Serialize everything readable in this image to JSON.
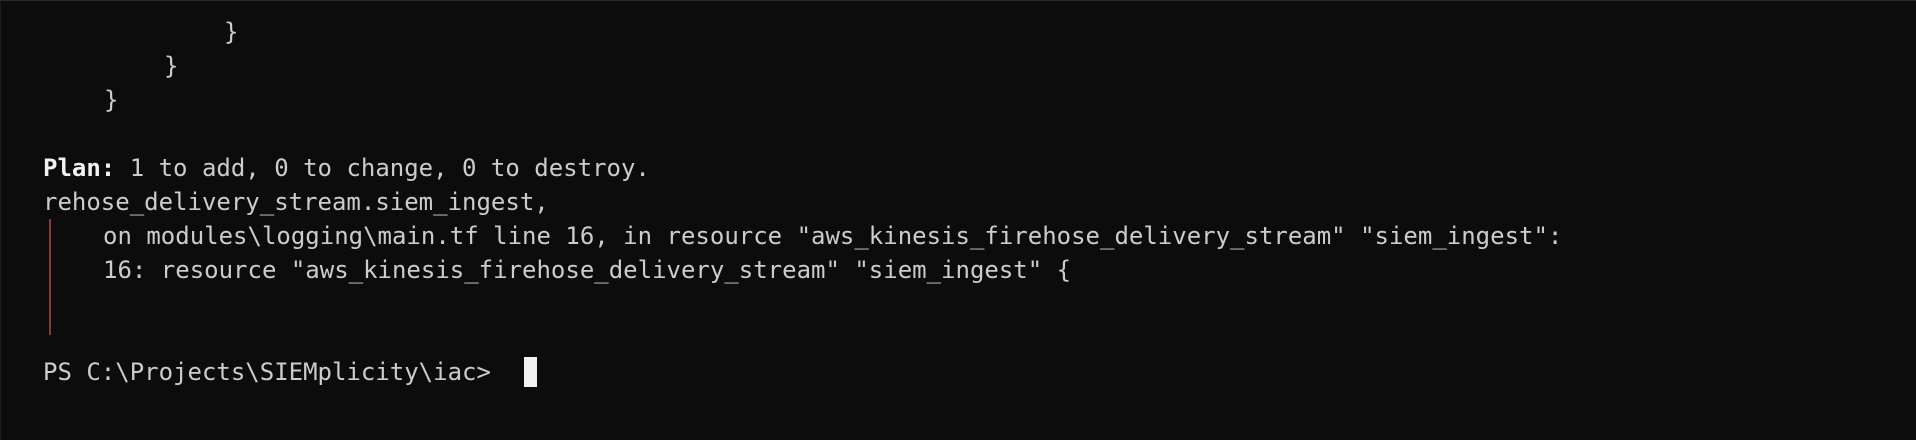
{
  "terminal": {
    "closing_braces": [
      "}",
      "}",
      "}"
    ],
    "plan": {
      "label": "Plan:",
      "text": " 1 to add, 0 to change, 0 to destroy."
    },
    "error": {
      "resource_ref": "rehose_delivery_stream.siem_ingest,",
      "location": "on modules\\logging\\main.tf line 16, in resource \"aws_kinesis_firehose_delivery_stream\" \"siem_ingest\":",
      "source_line": "16: resource \"aws_kinesis_firehose_delivery_stream\" \"siem_ingest\" {"
    },
    "prompt": "PS C:\\Projects\\SIEMplicity\\iac>"
  }
}
